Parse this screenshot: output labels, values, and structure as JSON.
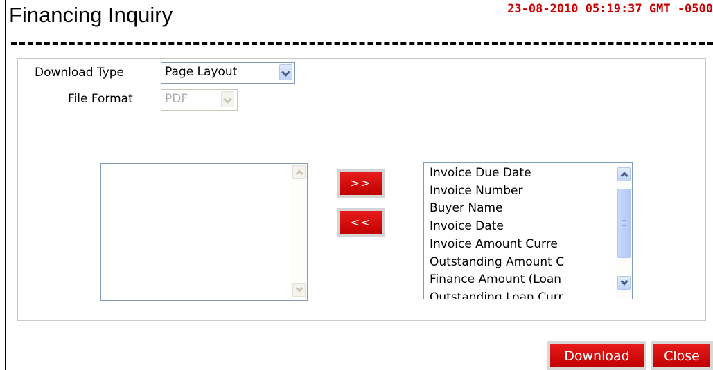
{
  "header": {
    "title": "Financing Inquiry",
    "timestamp": "23-08-2010 05:19:37 GMT -0500"
  },
  "form": {
    "download_type": {
      "label": "Download Type",
      "selected": "Page Layout"
    },
    "file_format": {
      "label": "File Format",
      "selected": "PDF",
      "disabled": true
    }
  },
  "available_columns": {
    "items": []
  },
  "selected_columns": {
    "items": [
      "Invoice Due Date",
      "Invoice Number",
      "Buyer Name",
      "Invoice Date",
      "Invoice Amount Curre",
      "Outstanding Amount C",
      "Finance Amount (Loan",
      "Outstanding Loan Curr"
    ]
  },
  "transfer": {
    "add_label": ">>",
    "remove_label": "<<"
  },
  "actions": {
    "download_label": "Download",
    "close_label": "Close"
  },
  "colors": {
    "accent_red": "#cc0000",
    "select_border": "#7f9db9"
  }
}
